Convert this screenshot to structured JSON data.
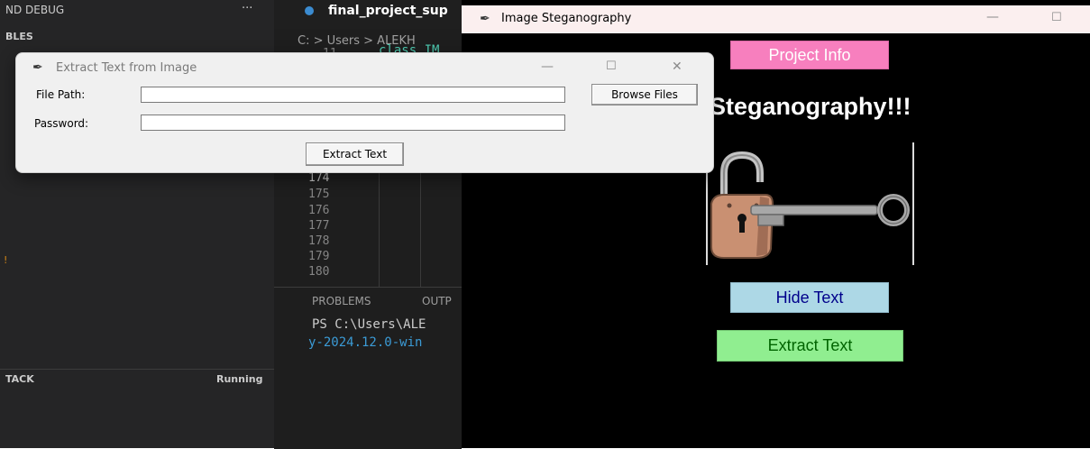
{
  "vscode": {
    "sidebar_header": "ND DEBUG",
    "sidebar_dots": "···",
    "variables_label": "BLES",
    "orange_mark": "!",
    "callstack_label": "TACK",
    "callstack_status": "Running",
    "tab_label": "final_project_sup",
    "breadcrumb": "C: > Users > ALEKH",
    "code_line_number": "11",
    "code_line_text": "class IM",
    "line_numbers": [
      "174",
      "175",
      "176",
      "177",
      "178",
      "179",
      "180"
    ],
    "panel_tabs": [
      "PROBLEMS",
      "OUTP"
    ],
    "terminal_line1": "PS C:\\Users\\ALE",
    "terminal_line2": "y-2024.12.0-win"
  },
  "extract_window": {
    "title": "Extract Text from Image",
    "file_path_label": "File Path:",
    "password_label": "Password:",
    "file_path_value": "",
    "password_value": "",
    "browse_button": "Browse Files",
    "extract_button": "Extract Text",
    "minimize": "—",
    "maximize": "☐",
    "close": "✕"
  },
  "steg_window": {
    "title": "Image Steganography",
    "minimize": "—",
    "maximize": "☐",
    "project_info_button": "Project Info",
    "heading": "Steganography!!!",
    "hide_text_button": "Hide Text",
    "extract_text_button": "Extract Text"
  },
  "colors": {
    "project_info_bg": "#f77fbe",
    "hide_text_bg": "#add8e6",
    "hide_text_fg": "#00008b",
    "extract_text_bg": "#90ee90",
    "extract_text_fg": "#006400"
  }
}
